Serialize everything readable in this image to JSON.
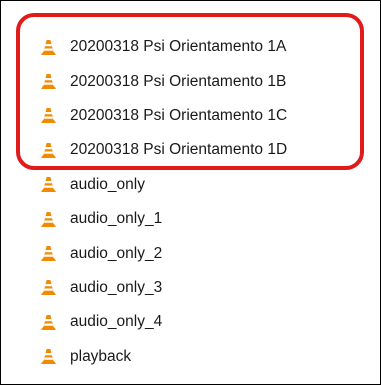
{
  "files": [
    {
      "name": "20200318 Psi Orientamento 1A",
      "icon": "vlc-cone-icon",
      "highlighted": true
    },
    {
      "name": "20200318 Psi Orientamento 1B",
      "icon": "vlc-cone-icon",
      "highlighted": true
    },
    {
      "name": "20200318 Psi Orientamento 1C",
      "icon": "vlc-cone-icon",
      "highlighted": true
    },
    {
      "name": "20200318 Psi Orientamento 1D",
      "icon": "vlc-cone-icon",
      "highlighted": true
    },
    {
      "name": "audio_only",
      "icon": "vlc-cone-icon",
      "highlighted": false
    },
    {
      "name": "audio_only_1",
      "icon": "vlc-cone-icon",
      "highlighted": false
    },
    {
      "name": "audio_only_2",
      "icon": "vlc-cone-icon",
      "highlighted": false
    },
    {
      "name": "audio_only_3",
      "icon": "vlc-cone-icon",
      "highlighted": false
    },
    {
      "name": "audio_only_4",
      "icon": "vlc-cone-icon",
      "highlighted": false
    },
    {
      "name": "playback",
      "icon": "vlc-cone-icon",
      "highlighted": false
    }
  ],
  "colors": {
    "highlight_border": "#e11b1b",
    "icon_orange": "#f08a00",
    "icon_stripe": "#ffffff",
    "text": "#1a1a1a"
  }
}
